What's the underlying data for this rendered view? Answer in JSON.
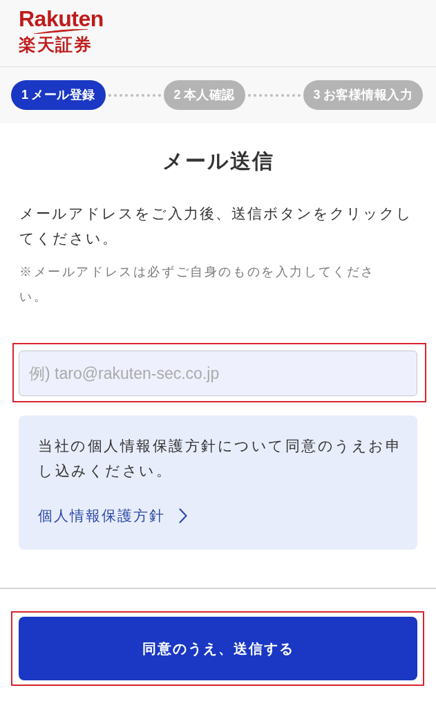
{
  "header": {
    "logo": {
      "wordmark": "Rakuten",
      "subtitle": "楽天証券"
    }
  },
  "steps": [
    {
      "number": "1",
      "label": "メール登録",
      "selected": true
    },
    {
      "number": "2",
      "label": "本人確認",
      "selected": false
    },
    {
      "number": "3",
      "label": "お客様情報入力",
      "selected": false
    }
  ],
  "title": "メール送信",
  "instructions": "メールアドレスをご入力後、送信ボタンをクリックしてください。",
  "note": "※メールアドレスは必ずご自身のものを入力してください。",
  "email_field": {
    "placeholder": "例) taro@rakuten-sec.co.jp",
    "highlighted": true
  },
  "consent": {
    "text": "当社の個人情報保護方針について同意のうえお申し込みください。",
    "link": "個人情報保護方針"
  },
  "submit_button": {
    "label": "同意のうえ、送信する",
    "highlighted": true
  }
}
